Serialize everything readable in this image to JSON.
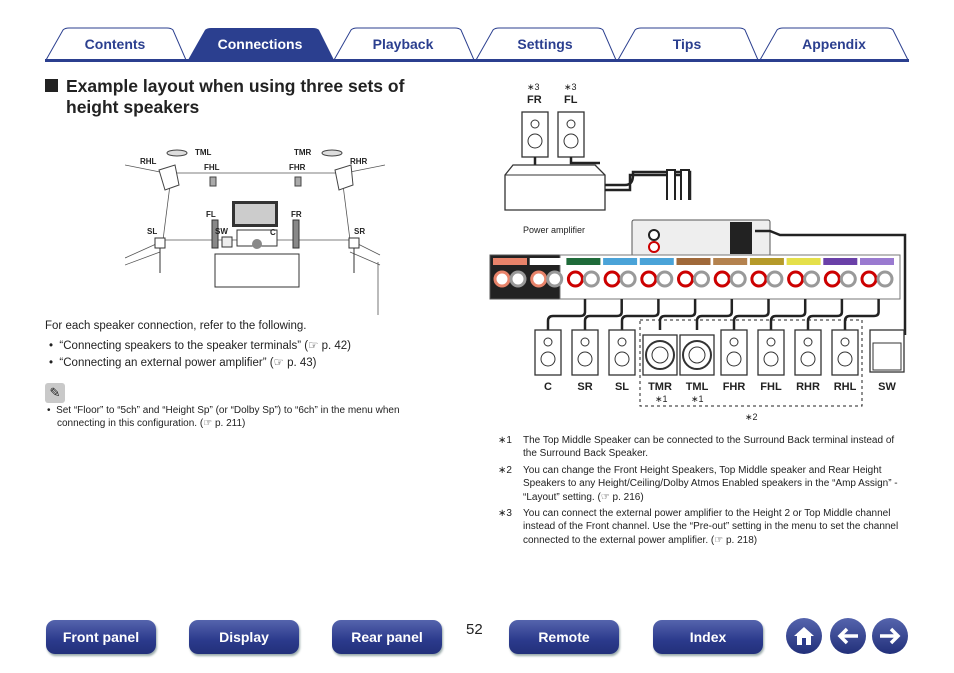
{
  "nav": {
    "tabs": [
      {
        "label": "Contents"
      },
      {
        "label": "Connections",
        "active": true
      },
      {
        "label": "Playback"
      },
      {
        "label": "Settings"
      },
      {
        "label": "Tips"
      },
      {
        "label": "Appendix"
      }
    ],
    "accent": "#2b3f8f"
  },
  "heading": {
    "line1": "Example layout when using three sets of",
    "line2": "height speakers"
  },
  "room": {
    "labels": {
      "tml": "TML",
      "tmr": "TMR",
      "rhl": "RHL",
      "rhr": "RHR",
      "fhl": "FHL",
      "fhr": "FHR",
      "fl": "FL",
      "fr": "FR",
      "sl": "SL",
      "sr": "SR",
      "sw": "SW",
      "c": "C"
    }
  },
  "intro": "For each speaker connection, refer to the following.",
  "links": [
    {
      "text": "“Connecting speakers to the speaker terminals” (",
      "page": " p. 42)"
    },
    {
      "text": "“Connecting an external power amplifier” (",
      "page": " p. 43)"
    }
  ],
  "note": {
    "icon": "pencil-icon",
    "line1": "Set “Floor” to “5ch” and “Height Sp” (or “Dolby Sp”) to “6ch” in the menu when",
    "line2": "connecting in this configuration.  (",
    "page": " p. 211)"
  },
  "wiring": {
    "top_speakers": [
      {
        "mark": "∗3",
        "label": "FR"
      },
      {
        "mark": "∗3",
        "label": "FL"
      }
    ],
    "power_amp": "Power amplifier",
    "speakers": [
      {
        "label": "C"
      },
      {
        "label": "SR"
      },
      {
        "label": "SL"
      },
      {
        "label": "TMR",
        "mark": "∗1"
      },
      {
        "label": "TML",
        "mark": "∗1"
      },
      {
        "label": "FHR"
      },
      {
        "label": "FHL"
      },
      {
        "label": "RHR"
      },
      {
        "label": "RHL"
      },
      {
        "label": "SW"
      }
    ],
    "group_mark": "∗2"
  },
  "footnotes": [
    {
      "mark": "∗1",
      "text": "The Top Middle Speaker can be connected to the Surround Back terminal instead of the Surround Back Speaker."
    },
    {
      "mark": "∗2",
      "text": "You can change the Front Height Speakers, Top Middle speaker and Rear Height Speakers to any Height/Ceiling/Dolby Atmos Enabled speakers in the “Amp Assign” - “Layout” setting.  (",
      "page": " p. 216)"
    },
    {
      "mark": "∗3",
      "text": "You can connect the external power amplifier to the Height 2 or Top Middle channel instead of the Front channel. Use the “Pre-out” setting in the menu to set the channel connected to the external power amplifier.  (",
      "page": " p. 218)"
    }
  ],
  "page_number": "52",
  "footer": {
    "buttons": [
      {
        "label": "Front panel"
      },
      {
        "label": "Display"
      },
      {
        "label": "Rear panel"
      },
      {
        "label": "Remote"
      },
      {
        "label": "Index"
      }
    ],
    "icons": [
      "home-icon",
      "arrow-left-icon",
      "arrow-right-icon"
    ]
  }
}
